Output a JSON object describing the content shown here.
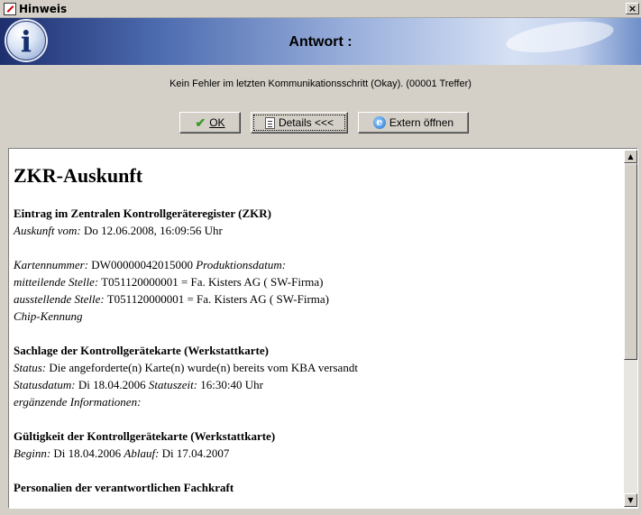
{
  "window": {
    "title": "Hinweis",
    "close_label": "×"
  },
  "banner": {
    "title": "Antwort :",
    "info_glyph": "i"
  },
  "status_message": "Kein Fehler im letzten Kommunikationsschritt (Okay). (00001 Treffer)",
  "buttons": {
    "ok": "OK",
    "details": "Details <<<",
    "extern": "Extern öffnen"
  },
  "scrollbar": {
    "up": "▲",
    "down": "▼"
  },
  "report": {
    "heading": "ZKR-Auskunft",
    "section1": {
      "title": "Eintrag im Zentralen Kontrollgeräteregister (ZKR)",
      "auskunft_label": "Auskunft vom:",
      "auskunft_value": "Do 12.06.2008, 16:09:56 Uhr"
    },
    "card": {
      "kartennummer_label": "Kartennummer:",
      "kartennummer_value": "DW00000042015000",
      "produktion_label": "Produktionsdatum:",
      "mitteilende_label": "mitteilende Stelle:",
      "mitteilende_value": "T051120000001 = Fa. Kisters AG ( SW-Firma)",
      "ausstellende_label": "ausstellende Stelle:",
      "ausstellende_value": "T051120000001 = Fa. Kisters AG ( SW-Firma)",
      "chip_label": "Chip-Kennung"
    },
    "section2": {
      "title": "Sachlage der Kontrollgerätekarte (Werkstattkarte)",
      "status_label": "Status:",
      "status_value": "Die angeforderte(n) Karte(n) wurde(n) bereits vom KBA versandt",
      "statusdatum_label": "Statusdatum:",
      "statusdatum_value": "Di 18.04.2006",
      "statuszeit_label": "Statuszeit:",
      "statuszeit_value": "16:30:40 Uhr",
      "ergaenzende_label": "ergänzende Informationen:"
    },
    "section3": {
      "title": "Gültigkeit der Kontrollgerätekarte (Werkstattkarte)",
      "beginn_label": "Beginn:",
      "beginn_value": "Di 18.04.2006",
      "ablauf_label": "Ablauf:",
      "ablauf_value": "Di 17.04.2007"
    },
    "section4": {
      "title": "Personalien der verantwortlichen Fachkraft"
    }
  }
}
